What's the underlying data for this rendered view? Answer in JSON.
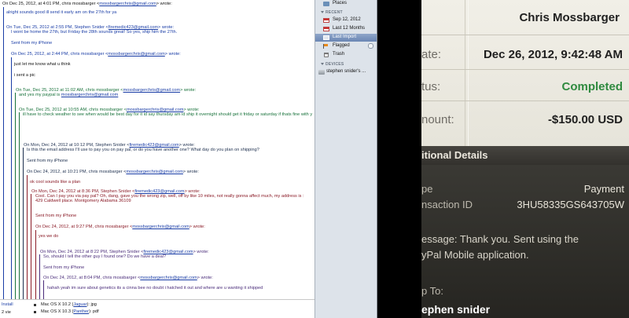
{
  "email": {
    "header_line": "On Dec 25, 2012, at 4:01 PM, chris mossbarger <",
    "header_email": "mossbargerchris@gmail.com",
    "header_end": "> wrote:",
    "l01": "alright sounds good ill send it early am on the 27th for ya",
    "l02a": "On Tue, Dec 25, 2012 at 2:55 PM, Stephen Snider <",
    "l02b": "firemedic423@gmail.com",
    "l02c": "> wrote:",
    "l03": "I wont be home the 27th, but Friday the 28th sounds great!  So yes, ship him the 27th.",
    "l04": "Sent from my iPhone",
    "l05a": "On Dec 25, 2012, at 2:44 PM, chris mossbarger <",
    "l05b": "mossbargerchris@gmail.com",
    "l05c": "> wrote:",
    "l06": "just let me know what u think",
    "l07": "i sent a pic",
    "l08a": "On Tue, Dec 25, 2012 at 11:02 AM, chris mossbarger <",
    "l08b": "mossbargerchris@gmail.com",
    "l08c": "> wrote:",
    "l09a": "and yes my paypal is ",
    "l09b": "mossbargerchris@gmail.com",
    "l10a": "On Tue, Dec 25, 2012 at 10:55 AM, chris mossbarger <",
    "l10b": "mossbargerchris@gmail.com",
    "l10c": "> wrote:",
    "l11": "ill have to check weather to see  when would be best day for it id say thursday am id ship it overnight should get it friday or saturday if thats fine with y",
    "l12a": "On Mon, Dec 24, 2012 at 10:12 PM, Stephen Snider <",
    "l12b": "firemedic423@gmail.com",
    "l12c": "> wrote:",
    "l13": "Is this the email address I'll use to pay you on pay pal, or do you have another one?  What day do you plan on shipping?",
    "l14": "Sent from my iPhone",
    "l15a": "On Dec 24, 2012, at 10:21 PM, chris mossbarger <",
    "l15b": "mossbargerchris@gmail.com",
    "l15c": "> wrote:",
    "l16": "ok cool sounds like a plan",
    "l17a": "On Mon, Dec 24, 2012 at 8:36 PM, Stephen Snider <",
    "l17b": "firemedic423@gmail.com",
    "l17c": "> wrote:",
    "l18": "Cool. Can I pay you via pay pal?  Oh, dang, gave you the wrong zip, well, off by like 10 miles, not really gonna affect much, my address is :",
    "l19": "429 Caldwell place. Montgomery Alabama 36109",
    "l20": "Sent from my iPhone",
    "l21a": "On Dec 24, 2012, at 9:27 PM, chris mossbarger <",
    "l21b": "mossbargerchris@gmail.com",
    "l21c": "> wrote:",
    "l22": "yes we do",
    "l23a": "On Mon, Dec 24, 2012 at 8:22 PM, Stephen Snider <",
    "l23b": "firemedic423@gmail.com",
    "l23c": "> wrote:",
    "l24": "So, should I tell the other guy I found one?  Do we have a deal?",
    "l25": "Sent from my iPhone",
    "l26a": "On Dec 24, 2012, at 8:04 PM, chris mossbarger <",
    "l26b": "mossbargerchris@gmail.com",
    "l26c": "> wrote:",
    "l27": "hahah yeah im sure about genetics its a cinna bee no doubt i hatched it out and where are u wanting it shipped"
  },
  "email_bottom": {
    "left_top": "Install",
    "left_bottom": "2 vie",
    "item1": "Mac OS X 10.2 (",
    "item1_link": "Jaguar",
    "item1_end": "): jpg",
    "item2": "Mac OS X 10.3 (",
    "item2_link": "Panther",
    "item2_end": "): pdf"
  },
  "sidebar": {
    "places": "Places",
    "recent_head": "RECENT",
    "recent_items": [
      "Sep 12, 2012",
      "Last 12 Months",
      "Last Import",
      "Flagged",
      "Trash"
    ],
    "devices_head": "DEVICES",
    "device": "stephen snider's ..."
  },
  "receipt": {
    "name": "Chris Mossbarger",
    "date_label": "ate:",
    "date_value": "Dec 26, 2012, 9:42:48 AM",
    "status_label": "tus:",
    "status_value": "Completed",
    "amount_label": "nount:",
    "amount_value": "-$150.00 USD",
    "section_title": "itional Details",
    "type_label": "pe",
    "type_value": "Payment",
    "txn_label": "nsaction ID",
    "txn_value": "3HU58335GS643705W",
    "message_line1": "essage: Thank you. Sent using the",
    "message_line2": "yPal Mobile application.",
    "ship_label": "p To:",
    "ship_name": "ephen snider"
  },
  "colors": {
    "status_green": "#2f8a3f",
    "link_blue": "#1a3da6",
    "selected_row": "#6a86b4"
  }
}
